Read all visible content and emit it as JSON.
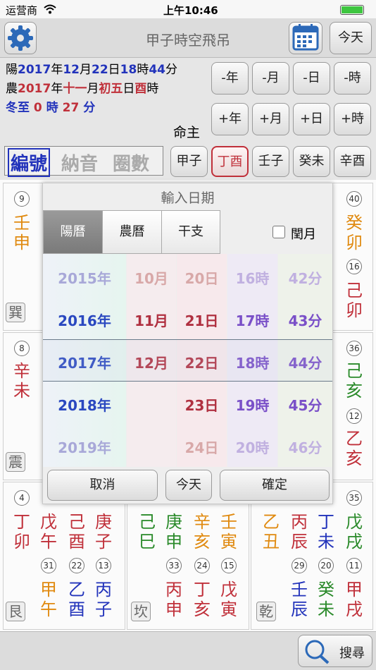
{
  "status": {
    "carrier": "运营商",
    "time": "上午10:46"
  },
  "nav": {
    "title": "甲子時空飛吊",
    "today_label": "今天"
  },
  "info": {
    "solar_prefix": "陽",
    "solar_year": "2017",
    "year_char": "年",
    "solar_month": "12",
    "month_char": "月",
    "solar_day": "22",
    "day_char": "日",
    "solar_hour": "18",
    "hour_char": "時",
    "solar_min": "44",
    "min_char": "分",
    "lunar_prefix": "農",
    "lunar_year": "2017",
    "lunar_month": "十一",
    "lunar_day": "初五",
    "lunar_hour": "酉",
    "term": "冬至",
    "term_hours": "0",
    "term_mins": "27",
    "ming_zhu": "命主"
  },
  "adjust": {
    "minus": [
      "-年",
      "-月",
      "-日",
      "-時"
    ],
    "plus": [
      "+年",
      "+月",
      "+日",
      "+時"
    ]
  },
  "tabs": {
    "t1": "編號",
    "t2": "納音",
    "t3": "圈數"
  },
  "pillars": [
    "甲子",
    "丁酉",
    "壬子",
    "癸未",
    "辛酉"
  ],
  "grid": {
    "c1": [
      {
        "num": "9",
        "g1": "壬",
        "g2": "申",
        "palace": "巽"
      },
      {
        "num": "8",
        "g1": "辛",
        "g2": "未",
        "palace": "震"
      },
      {
        "num": "4",
        "cols": [
          [
            "丁",
            "卯"
          ],
          [
            "戊",
            "午"
          ],
          [
            "己",
            "酉"
          ],
          [
            "庚",
            "子"
          ]
        ],
        "nums2": [
          "31",
          "22",
          "13"
        ],
        "low": [
          [
            "甲",
            "午"
          ],
          [
            "乙",
            "酉"
          ],
          [
            "丙",
            "子"
          ]
        ],
        "palace": "艮"
      }
    ],
    "c2": {
      "cols": [
        [
          "己",
          "巳"
        ],
        [
          "庚",
          "申"
        ],
        [
          "辛",
          "亥"
        ],
        [
          "壬",
          "寅"
        ]
      ],
      "nums2": [
        "33",
        "24",
        "15"
      ],
      "low": [
        [
          "丙",
          "申"
        ],
        [
          "丁",
          "亥"
        ],
        [
          "戊",
          "寅"
        ]
      ],
      "palace": "坎"
    },
    "c3": {
      "top": [
        {
          "num": "40",
          "g1": "癸",
          "g2": "卯"
        },
        {
          "num": "16",
          "g1": "己",
          "g2": "卯"
        }
      ],
      "mid": [
        {
          "num": "36",
          "g1": "己",
          "g2": "亥"
        },
        {
          "num": "12",
          "g1": "乙",
          "g2": "亥"
        }
      ],
      "bot": {
        "num": "35",
        "cols": [
          [
            "乙",
            "丑"
          ],
          [
            "丙",
            "辰"
          ],
          [
            "丁",
            "未"
          ],
          [
            "戊",
            "戌"
          ]
        ],
        "nums2": [
          "29",
          "20",
          "11"
        ],
        "low": [
          [
            "壬",
            "辰"
          ],
          [
            "癸",
            "未"
          ],
          [
            "甲",
            "戌"
          ]
        ],
        "palace": "乾"
      }
    }
  },
  "dialog": {
    "title": "輸入日期",
    "segments": [
      "陽曆",
      "農曆",
      "干支"
    ],
    "leap_label": "閏月",
    "years": [
      "2015年",
      "2016年",
      "2017年",
      "2018年",
      "2019年"
    ],
    "months": [
      "10月",
      "11月",
      "12月"
    ],
    "days": [
      "20日",
      "21日",
      "22日",
      "23日",
      "24日"
    ],
    "hours": [
      "16時",
      "17時",
      "18時",
      "19時",
      "20時"
    ],
    "mins": [
      "42分",
      "43分",
      "44分",
      "45分",
      "46分"
    ],
    "cancel": "取消",
    "today": "今天",
    "confirm": "確定"
  },
  "bottom": {
    "search": "搜尋"
  }
}
